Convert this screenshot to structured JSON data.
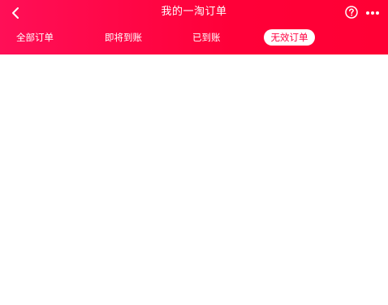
{
  "header": {
    "title": "我的一淘订单",
    "back_icon": "chevron-left-icon",
    "help_icon": "question-circle-icon",
    "more_icon": "more-dots-icon",
    "background_color": "#ff0f57"
  },
  "tabs": [
    {
      "label": "全部订单",
      "active": false
    },
    {
      "label": "即将到账",
      "active": false
    },
    {
      "label": "已到账",
      "active": false
    },
    {
      "label": "无效订单",
      "active": true
    }
  ],
  "colors": {
    "accent": "#ff0040",
    "text_on_header": "#ffffff",
    "content_bg": "#ffffff"
  }
}
